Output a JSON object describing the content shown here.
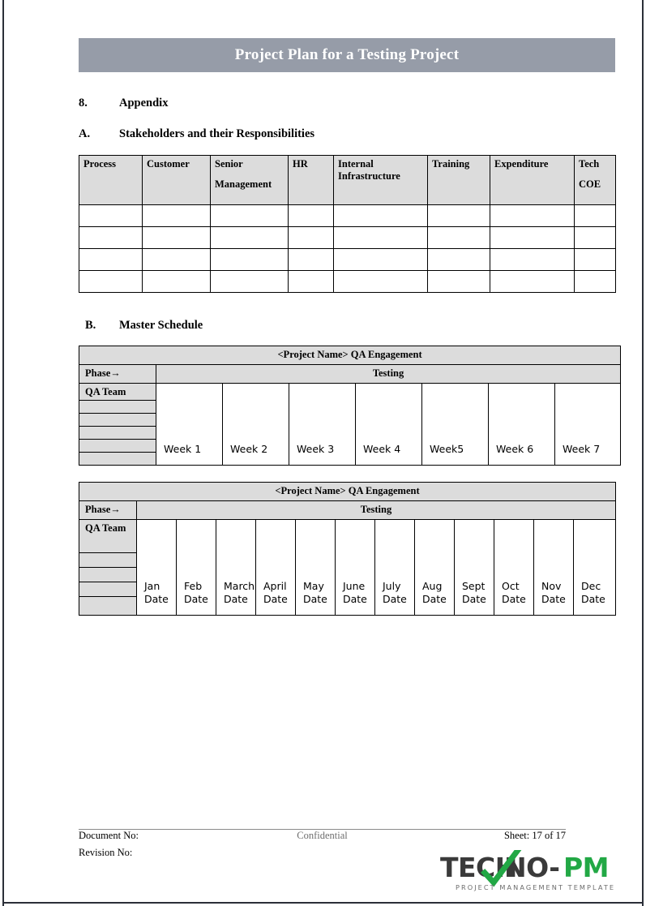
{
  "document": {
    "title": "Project Plan for a Testing Project",
    "banner_bg": "#969ca8"
  },
  "sections": {
    "appendix": {
      "number": "8.",
      "title": "Appendix"
    },
    "stakeholders": {
      "number": "A.",
      "title": "Stakeholders and their Responsibilities"
    },
    "master_schedule": {
      "number": "B.",
      "title": "Master Schedule"
    }
  },
  "stakeholders_table": {
    "headers": [
      {
        "line1": "Process",
        "line2": ""
      },
      {
        "line1": "Customer",
        "line2": ""
      },
      {
        "line1": "Senior",
        "line2": "Management"
      },
      {
        "line1": "HR",
        "line2": ""
      },
      {
        "line1": "Internal",
        "line2": "Infrastructure"
      },
      {
        "line1": "Training",
        "line2": ""
      },
      {
        "line1": "Expenditure",
        "line2": ""
      },
      {
        "line1": "Tech",
        "line2": "COE"
      }
    ],
    "body_rows": 4,
    "header_bg": "#dcdcdc"
  },
  "schedule_weeks": {
    "title": "<Project Name> QA Engagement",
    "phase_label": "Phase→",
    "phase_value": "Testing",
    "team_label": "QA Team",
    "team_blank_rows": 5,
    "periods": [
      {
        "name": "Week 1",
        "sub": ""
      },
      {
        "name": "Week 2",
        "sub": ""
      },
      {
        "name": "Week 3",
        "sub": ""
      },
      {
        "name": "Week 4",
        "sub": ""
      },
      {
        "name": "Week5",
        "sub": ""
      },
      {
        "name": "Week 6",
        "sub": ""
      },
      {
        "name": "Week 7",
        "sub": ""
      }
    ]
  },
  "schedule_months": {
    "title": "<Project Name> QA Engagement",
    "phase_label": "Phase→",
    "phase_value": "Testing",
    "team_label": "QA Team",
    "team_blank_rows": 4,
    "periods": [
      {
        "name": "Jan",
        "sub": "Date"
      },
      {
        "name": "Feb",
        "sub": "Date"
      },
      {
        "name": "March",
        "sub": "Date"
      },
      {
        "name": "April",
        "sub": "Date"
      },
      {
        "name": "May",
        "sub": "Date"
      },
      {
        "name": "June",
        "sub": "Date"
      },
      {
        "name": "July",
        "sub": "Date"
      },
      {
        "name": "Aug",
        "sub": "Date"
      },
      {
        "name": "Sept",
        "sub": "Date"
      },
      {
        "name": "Oct",
        "sub": "Date"
      },
      {
        "name": "Nov",
        "sub": "Date"
      },
      {
        "name": "Dec",
        "sub": "Date"
      }
    ]
  },
  "footer": {
    "document_no": "Document No:",
    "revision_no": "Revision No:",
    "confidential": "Confidential",
    "sheet": "Sheet: 17 of 17"
  },
  "logo": {
    "text_part1": "TECH",
    "text_part2": "NO-",
    "text_part3": "PM",
    "tagline": "PROJECT MANAGEMENT TEMPLATES",
    "dark_color": "#3a3a3a",
    "green_color": "#22a845",
    "check_icon": "check-mark-icon"
  }
}
